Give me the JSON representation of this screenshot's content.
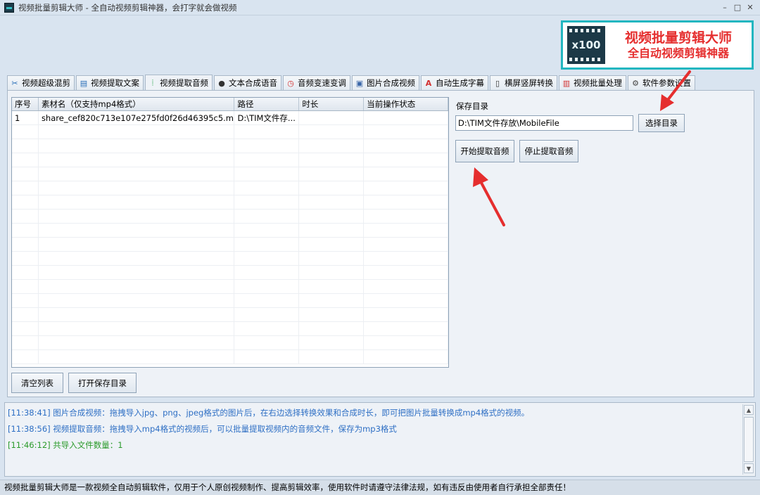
{
  "window": {
    "title": "视频批量剪辑大师 - 全自动视频剪辑神器，会打字就会做视频",
    "controls": {
      "minimize": "–",
      "maximize": "□",
      "close": "✕"
    }
  },
  "banner": {
    "logo_text": "x100",
    "line1": "视频批量剪辑大师",
    "line2": "全自动视频剪辑神器"
  },
  "tabs": [
    {
      "label": "视频超级混剪",
      "icon": "scissors-icon",
      "glyph": "✂"
    },
    {
      "label": "视频提取文案",
      "icon": "document-icon",
      "glyph": "▤"
    },
    {
      "label": "视频提取音频",
      "icon": "waveform-icon",
      "glyph": "⦙"
    },
    {
      "label": "文本合成语音",
      "icon": "microphone-icon",
      "glyph": "●"
    },
    {
      "label": "音频变速变调",
      "icon": "gauge-icon",
      "glyph": "◷"
    },
    {
      "label": "图片合成视频",
      "icon": "image-icon",
      "glyph": "▣"
    },
    {
      "label": "自动生成字幕",
      "icon": "subtitle-icon",
      "glyph": "A"
    },
    {
      "label": "横屏竖屏转换",
      "icon": "rotate-screen-icon",
      "glyph": "▯"
    },
    {
      "label": "视频批量处理",
      "icon": "film-icon",
      "glyph": "▥"
    },
    {
      "label": "软件参数设置",
      "icon": "gear-icon",
      "glyph": "⚙"
    }
  ],
  "active_tab": 2,
  "table": {
    "columns": [
      "序号",
      "素材名（仅支持mp4格式）",
      "路径",
      "时长",
      "当前操作状态"
    ],
    "rows": [
      [
        "1",
        "share_cef820c713e107e275fd0f26d46395c5.mp4",
        "D:\\TIM文件存...",
        "",
        ""
      ]
    ]
  },
  "buttons": {
    "clear_list": "清空列表",
    "open_save_dir": "打开保存目录",
    "choose_dir": "选择目录",
    "start_extract": "开始提取音频",
    "stop_extract": "停止提取音频"
  },
  "save_dir": {
    "label": "保存目录",
    "value": "D:\\TIM文件存放\\MobileFile"
  },
  "log": [
    {
      "text": "[11:38:41] 图片合成视频：拖拽导入jpg、png、jpeg格式的图片后，在右边选择转换效果和合成时长，即可把图片批量转换成mp4格式的视频。",
      "color": "#2e6fc4"
    },
    {
      "text": "[11:38:56] 视频提取音频：拖拽导入mp4格式的视频后，可以批量提取视频内的音频文件，保存为mp3格式",
      "color": "#2e6fc4"
    },
    {
      "text": "[11:46:12] 共导入文件数量：1",
      "color": "#2a9a2a"
    }
  ],
  "status_text": "视频批量剪辑大师是一款视频全自动剪辑软件，仅用于个人原创视频制作、提高剪辑效率，使用软件时请遵守法律法规，如有违反由使用者自行承担全部责任！",
  "colors": {
    "accent": "#23b6c0",
    "arrow": "#e52e2e"
  }
}
